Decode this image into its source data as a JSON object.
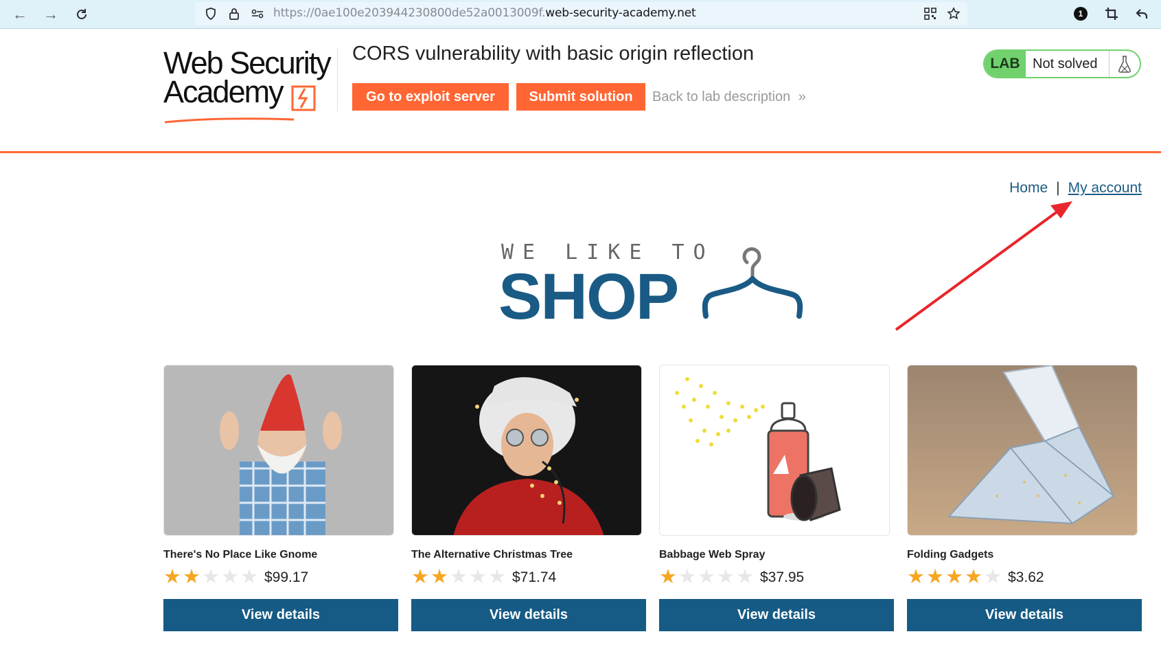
{
  "browser": {
    "url_prefix": "https://0ae100e203944230800de52a0013009f.",
    "url_host": "web-security-academy.net",
    "extension_badge": "1"
  },
  "header": {
    "logo_line1": "Web Security",
    "logo_line2": "Academy",
    "lab_title": "CORS vulnerability with basic origin reflection",
    "exploit_button": "Go to exploit server",
    "submit_button": "Submit solution",
    "back_link": "Back to lab description",
    "lab_badge": "LAB",
    "lab_status": "Not solved"
  },
  "nav": {
    "home": "Home",
    "separator": "|",
    "account": "My account"
  },
  "banner": {
    "top": "WE LIKE TO",
    "main": "SHOP"
  },
  "products": [
    {
      "name": "There's No Place Like Gnome",
      "stars": 2,
      "price": "$99.17",
      "button": "View details"
    },
    {
      "name": "The Alternative Christmas Tree",
      "stars": 2,
      "price": "$71.74",
      "button": "View details"
    },
    {
      "name": "Babbage Web Spray",
      "stars": 1,
      "price": "$37.95",
      "button": "View details"
    },
    {
      "name": "Folding Gadgets",
      "stars": 4,
      "price": "$3.62",
      "button": "View details"
    }
  ],
  "colors": {
    "accent_orange": "#ff6633",
    "brand_blue": "#165b85",
    "lab_green": "#70d16d",
    "star_gold": "#f6a623",
    "annotation_red": "#e8262b"
  }
}
